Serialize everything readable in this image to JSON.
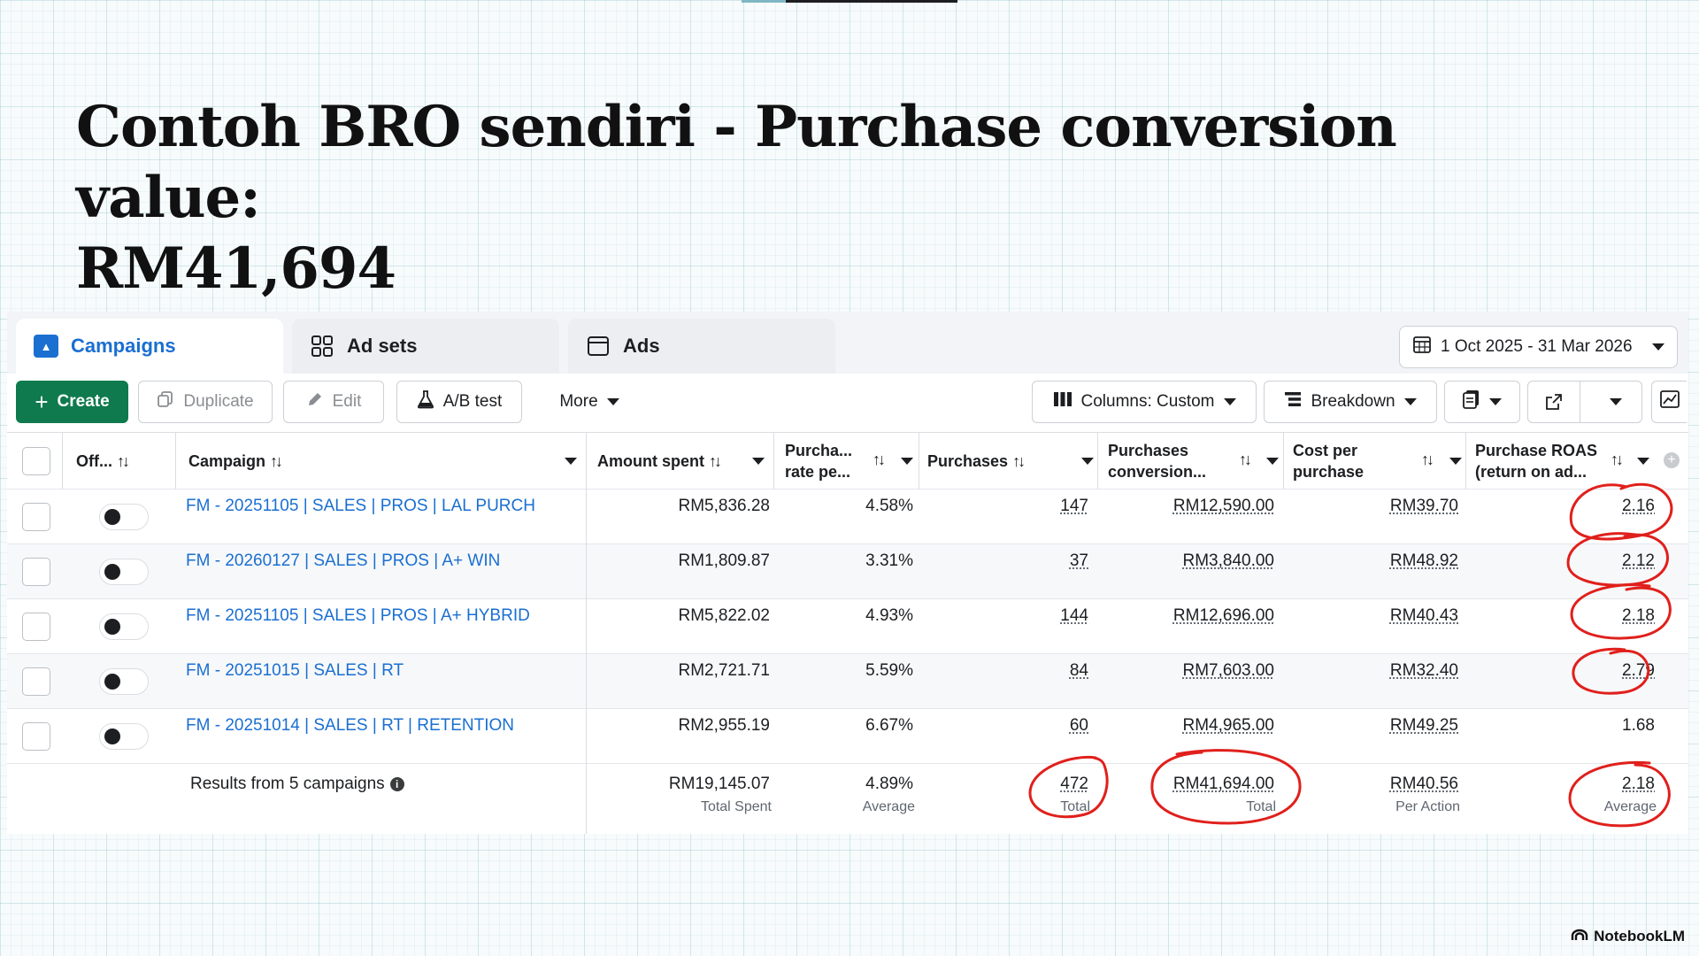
{
  "slide": {
    "title_line1": "Contoh BRO sendiri - Purchase conversion value:",
    "title_line2": "RM41,694"
  },
  "tabs": [
    {
      "label": "Campaigns",
      "icon": "campaign-icon",
      "active": true
    },
    {
      "label": "Ad sets",
      "icon": "grid-icon",
      "active": false
    },
    {
      "label": "Ads",
      "icon": "window-icon",
      "active": false
    }
  ],
  "date_range": "1 Oct 2025 - 31 Mar 2026",
  "toolbar": {
    "create": "Create",
    "duplicate": "Duplicate",
    "edit": "Edit",
    "ab_test": "A/B test",
    "more": "More",
    "columns": "Columns: Custom",
    "breakdown": "Breakdown"
  },
  "columns": {
    "off": "Off...",
    "campaign": "Campaign",
    "amount_spent": "Amount spent",
    "purchase_rate_1": "Purcha...",
    "purchase_rate_2": "rate pe...",
    "purchases": "Purchases",
    "conv_value_1": "Purchases",
    "conv_value_2": "conversion...",
    "cost_per_1": "Cost per",
    "cost_per_2": "purchase",
    "roas_1": "Purchase ROAS",
    "roas_2": "(return on ad..."
  },
  "rows": [
    {
      "campaign": "FM - 20251105 | SALES | PROS | LAL PURCH",
      "amount_spent": "RM5,836.28",
      "purchase_rate": "4.58%",
      "purchases": "147",
      "conversion_value": "RM12,590.00",
      "cost_per_purchase": "RM39.70",
      "roas": "2.16"
    },
    {
      "campaign": "FM - 20260127 | SALES | PROS | A+ WIN",
      "amount_spent": "RM1,809.87",
      "purchase_rate": "3.31%",
      "purchases": "37",
      "conversion_value": "RM3,840.00",
      "cost_per_purchase": "RM48.92",
      "roas": "2.12"
    },
    {
      "campaign": "FM - 20251105 | SALES | PROS | A+ HYBRID",
      "amount_spent": "RM5,822.02",
      "purchase_rate": "4.93%",
      "purchases": "144",
      "conversion_value": "RM12,696.00",
      "cost_per_purchase": "RM40.43",
      "roas": "2.18"
    },
    {
      "campaign": "FM - 20251015 | SALES | RT",
      "amount_spent": "RM2,721.71",
      "purchase_rate": "5.59%",
      "purchases": "84",
      "conversion_value": "RM7,603.00",
      "cost_per_purchase": "RM32.40",
      "roas": "2.79"
    },
    {
      "campaign": "FM - 20251014 | SALES | RT | RETENTION",
      "amount_spent": "RM2,955.19",
      "purchase_rate": "6.67%",
      "purchases": "60",
      "conversion_value": "RM4,965.00",
      "cost_per_purchase": "RM49.25",
      "roas": "1.68"
    }
  ],
  "totals": {
    "label": "Results from 5 campaigns",
    "amount_spent": "RM19,145.07",
    "amount_spent_sub": "Total Spent",
    "purchase_rate": "4.89%",
    "purchase_rate_sub": "Average",
    "purchases": "472",
    "purchases_sub": "Total",
    "conversion_value": "RM41,694.00",
    "conversion_value_sub": "Total",
    "cost_per_purchase": "RM40.56",
    "cost_per_purchase_sub": "Per Action",
    "roas": "2.18",
    "roas_sub": "Average"
  },
  "annotation_color": "#e0201c",
  "brand": "NotebookLM"
}
